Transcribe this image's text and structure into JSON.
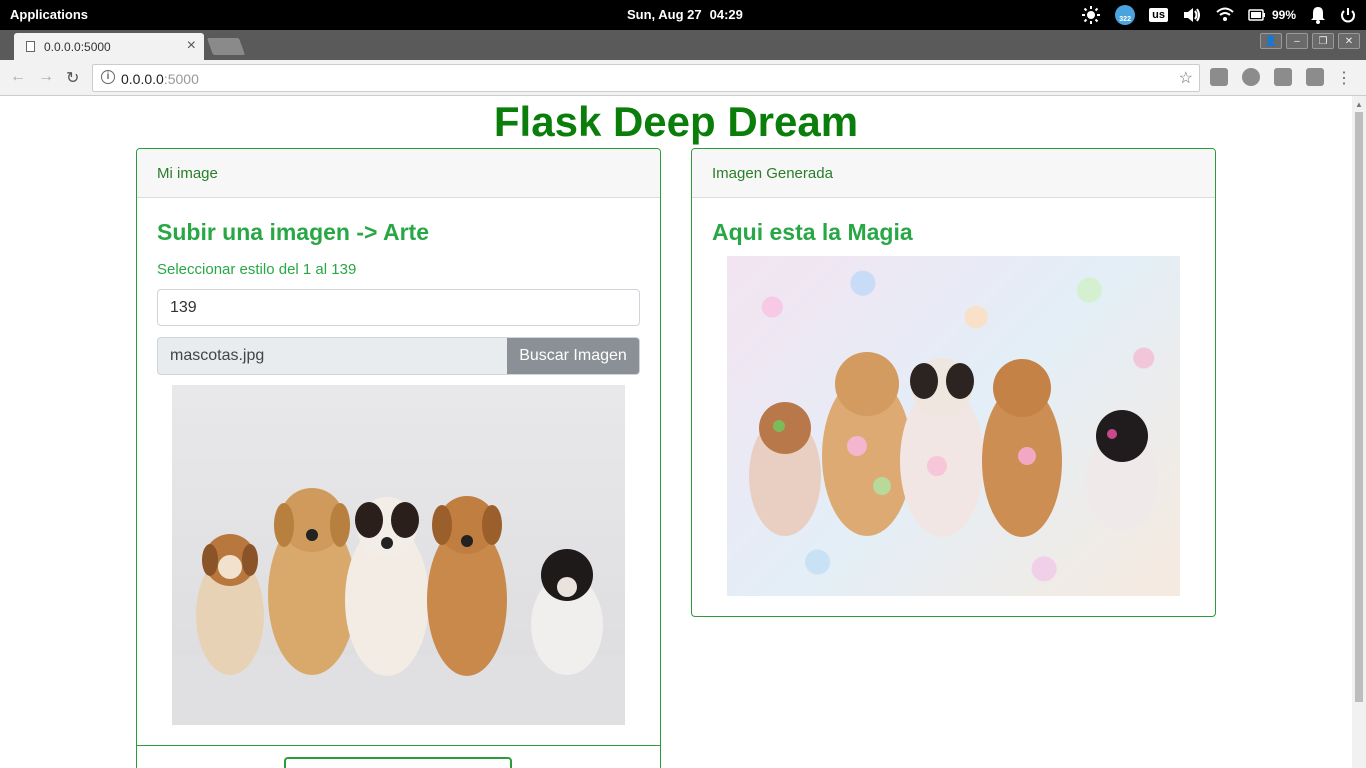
{
  "system": {
    "apps_label": "Applications",
    "date": "Sun, Aug 27",
    "time": "04:29",
    "notif_count": "322",
    "keyboard_layout": "us",
    "battery": "99%"
  },
  "browser": {
    "tab_title": "0.0.0.0:5000",
    "url_host": "0.0.0.0",
    "url_port": ":5000"
  },
  "page": {
    "title": "Flask Deep Dream",
    "left_card": {
      "header": "Mi image",
      "title": "Subir una imagen -> Arte",
      "style_label": "Seleccionar estilo del 1 al 139",
      "style_value": "139",
      "file_name": "mascotas.jpg",
      "browse_button": "Buscar Imagen",
      "image_alt": "Five puppies sitting in a row"
    },
    "right_card": {
      "header": "Imagen Generada",
      "title": "Aqui esta la Magia",
      "image_alt": "Deep dream version of the five puppies"
    }
  },
  "colors": {
    "brand_green": "#0a7d0a",
    "accent_green": "#28a745"
  }
}
